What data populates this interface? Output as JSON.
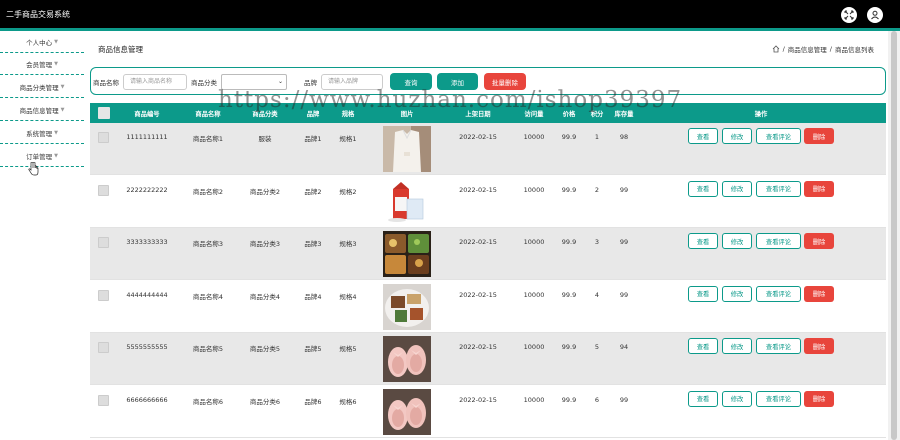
{
  "app": {
    "title": "二手商品交易系统",
    "accent": "#0c9a8a",
    "danger": "#e8453c",
    "icons": [
      "expand-icon",
      "user-icon"
    ]
  },
  "sidebar": {
    "items": [
      {
        "label": "个人中心"
      },
      {
        "label": "会员管理"
      },
      {
        "label": "商品分类管理"
      },
      {
        "label": "商品信息管理"
      },
      {
        "label": "系统管理"
      },
      {
        "label": "订单管理"
      }
    ]
  },
  "page": {
    "title": "商品信息管理",
    "breadcrumb": [
      "商品信息管理",
      "商品信息列表"
    ]
  },
  "search": {
    "name_label": "商品名称",
    "name_placeholder": "请输入商品名称",
    "category_label": "商品分类",
    "category_value": "",
    "brand_label": "品牌",
    "brand_placeholder": "请输入品牌",
    "query_button": "查询",
    "add_button": "添加",
    "batch_delete_button": "批量删除"
  },
  "table": {
    "headers": [
      "商品编号",
      "商品名称",
      "商品分类",
      "品牌",
      "规格",
      "图片",
      "上架日期",
      "访问量",
      "价格",
      "积分",
      "库存量",
      "操作"
    ],
    "actions": {
      "view": "查看",
      "edit": "修改",
      "reviews": "查看评论",
      "delete": "删除"
    },
    "rows": [
      {
        "id": "1111111111",
        "name": "商品名称1",
        "category": "服装",
        "brand": "品牌1",
        "spec": "规格1",
        "image": "white-blouse",
        "date": "2022-02-15",
        "views": "10000",
        "price": "99.9",
        "points": "1",
        "stock": "98"
      },
      {
        "id": "2222222222",
        "name": "商品名称2",
        "category": "商品分类2",
        "brand": "品牌2",
        "spec": "规格2",
        "image": "milk-carton",
        "date": "2022-02-15",
        "views": "10000",
        "price": "99.9",
        "points": "2",
        "stock": "99"
      },
      {
        "id": "3333333333",
        "name": "商品名称3",
        "category": "商品分类3",
        "brand": "品牌3",
        "spec": "规格3",
        "image": "bento-box",
        "date": "2022-02-15",
        "views": "10000",
        "price": "99.9",
        "points": "3",
        "stock": "99"
      },
      {
        "id": "4444444444",
        "name": "商品名称4",
        "category": "商品分类4",
        "brand": "品牌4",
        "spec": "规格4",
        "image": "food-plate",
        "date": "2022-02-15",
        "views": "10000",
        "price": "99.9",
        "points": "4",
        "stock": "99"
      },
      {
        "id": "5555555555",
        "name": "商品名称5",
        "category": "商品分类5",
        "brand": "品牌5",
        "spec": "规格5",
        "image": "pink-shoes",
        "date": "2022-02-15",
        "views": "10000",
        "price": "99.9",
        "points": "5",
        "stock": "94"
      },
      {
        "id": "6666666666",
        "name": "商品名称6",
        "category": "商品分类6",
        "brand": "品牌6",
        "spec": "规格6",
        "image": "pink-shoes",
        "date": "2022-02-15",
        "views": "10000",
        "price": "99.9",
        "points": "6",
        "stock": "99"
      }
    ]
  },
  "watermark": "https://www.huzhan.com/ishop39397"
}
